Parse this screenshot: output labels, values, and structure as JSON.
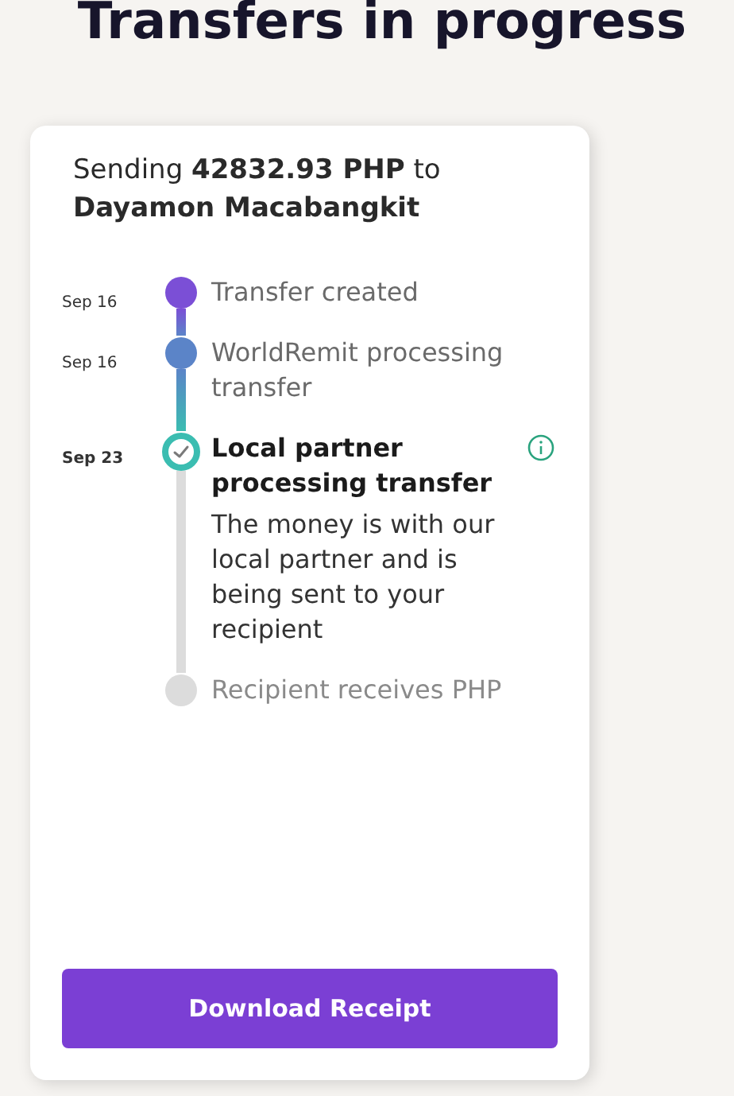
{
  "title": "Transfers in progress",
  "summary": "Sending **42832.93 PHP** to",
  "recipient": "Dayamon Macabangkit",
  "steps": [
    {
      "date": "Sep 16",
      "title": "Transfer created",
      "kind": "done",
      "color": "#7b4fd6",
      "info": false
    },
    {
      "date": "Sep 16",
      "title": "WorldRemit processing transfer",
      "kind": "done",
      "color": "#5b84c8",
      "info": false
    },
    {
      "date": "Sep 23",
      "title": "Local partner processing transfer",
      "description": "The money is with our local partner and is being sent to your recipient",
      "kind": "current",
      "color": "#3bbdb1",
      "info": true
    },
    {
      "title": "Recipient receives PHP",
      "kind": "pending",
      "color": "#dcdcdc",
      "info": false
    }
  ],
  "button": "Download Receipt"
}
